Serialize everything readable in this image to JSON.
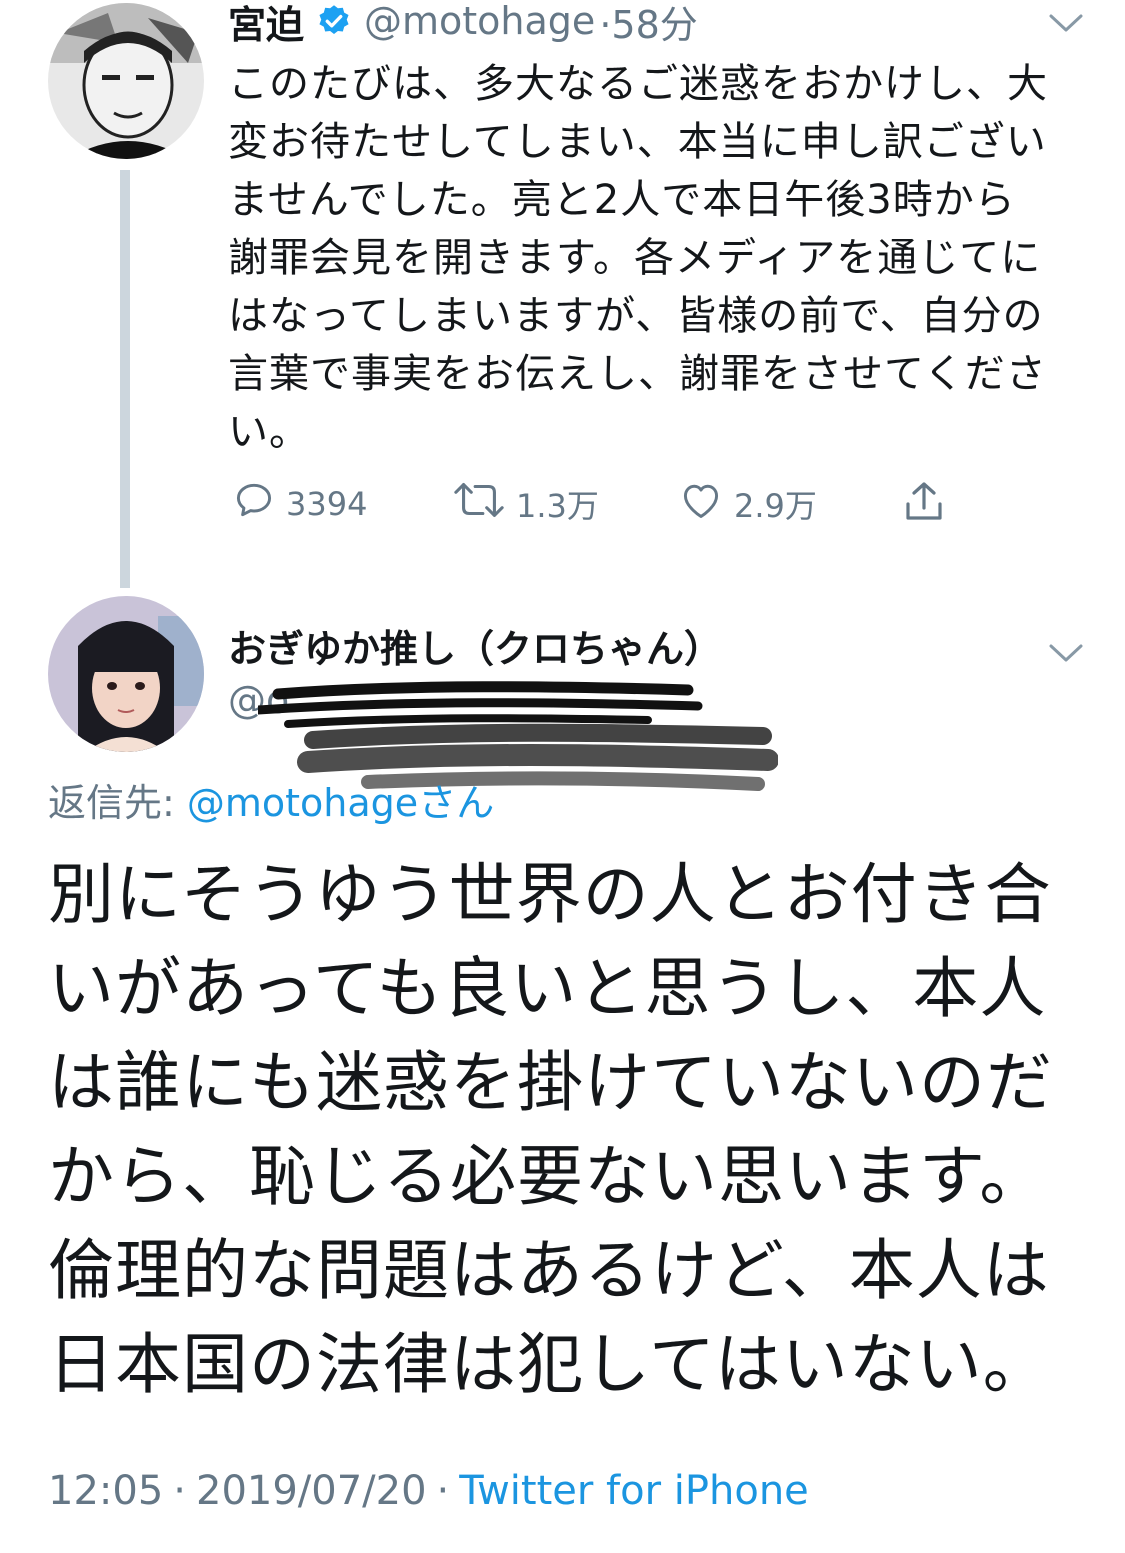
{
  "tweet1": {
    "author_name": "宮迫",
    "handle": "@motohage",
    "time": "·58分",
    "text": "このたびは、多大なるご迷惑をおかけし、大\n変お待たせしてしまい、本当に申し訳ござい\nませんでした。亮と2人で本日午後3時から\n謝罪会見を開きます。各メディアを通じてに\nはなってしまいますが、皆様の前で、自分の\n言葉で事実をお伝えし、謝罪をさせてくださ\nい。",
    "replies": "3394",
    "retweets": "1.3万",
    "likes": "2.9万",
    "verified_icon": "verified-badge-icon",
    "accent": "#1da1f2"
  },
  "tweet2": {
    "author_name": "おぎゆか推し（クロちゃん）",
    "handle_visible": "@o",
    "reply_to_label": "返信先: ",
    "reply_to_handle": "@motohage",
    "reply_to_suffix": "さん",
    "text": "別にそうゆう世界の人とお付き合\nいがあっても良いと思うし、本人\nは誰にも迷惑を掛けていないのだ\nから、恥じる必要ない思います。\n倫理的な問題はあるけど、本人は\n日本国の法律は犯してはいない。",
    "time": "12:05",
    "date": "2019/07/20",
    "source": "Twitter for iPhone",
    "sep": "·"
  },
  "colors": {
    "text": "#14171a",
    "secondary": "#657786",
    "link": "#1b95e0",
    "thread_line": "#ccd6dd"
  }
}
